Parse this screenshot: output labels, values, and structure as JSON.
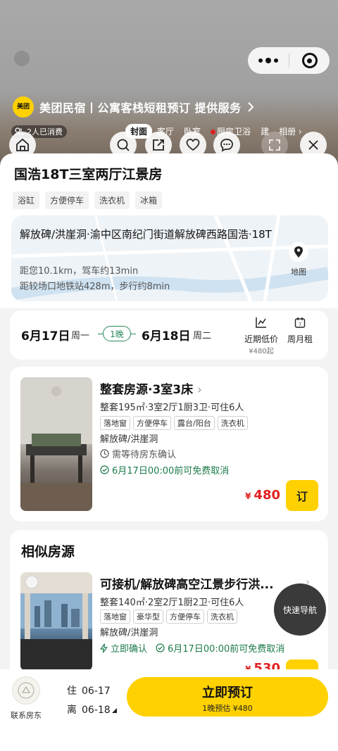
{
  "header": {
    "brand_logo_text": "美团",
    "brand_title": "美团民宿丨公寓客栈短租预订 提供服务",
    "consumed_badge": "2人已消费",
    "gallery_tabs": [
      "封面",
      "客厅",
      "卧室",
      "厨房卫浴",
      "建",
      "相册"
    ],
    "active_tab": "封面"
  },
  "listing": {
    "title": "国浩18T三室两厅江景房",
    "amenities": [
      "浴缸",
      "方便停车",
      "洗衣机",
      "冰箱"
    ]
  },
  "address": {
    "full": "解放碑/洪崖洞·渝中区南纪门街道解放碑西路国浩·18T",
    "distance_drive": "距您10.1km，驾车约13min",
    "distance_metro": "距较场口地铁站428m，步行约8min",
    "map_label": "地图"
  },
  "dates": {
    "checkin_date": "6月17日",
    "checkin_weekday": "周一",
    "nights": "1晚",
    "checkout_date": "6月18日",
    "checkout_weekday": "周二",
    "low_price_label": "近期低价",
    "low_price_value": "¥480起",
    "weekly_label": "周月租"
  },
  "room": {
    "title": "整套房源·3室3床",
    "spec": "整套195㎡·3室2厅1厨3卫·可住6人",
    "tags": [
      "落地窗",
      "方便停车",
      "露台/阳台",
      "洗衣机"
    ],
    "area": "解放碑/洪崖洞",
    "confirm": "需等待房东确认",
    "cancel": "6月17日00:00前可免费取消",
    "currency": "¥",
    "price": "480",
    "book_label": "订"
  },
  "similar": {
    "heading": "相似房源",
    "title": "可接机/解放碑高空江景步行洪...",
    "spec": "整套140㎡·2室2厅1厨2卫·可住6人",
    "tags": [
      "落地窗",
      "豪华型",
      "方便停车",
      "洗衣机"
    ],
    "area": "解放碑/洪崖洞",
    "instant": "立即确认",
    "cancel": "6月17日00:00前可免费取消",
    "currency": "¥",
    "price": "530"
  },
  "quick_nav": "快速导航",
  "bottom": {
    "contact_label": "联系房东",
    "checkin_prefix": "住",
    "checkin": "06-17",
    "checkout_prefix": "离",
    "checkout": "06-18",
    "book_main": "立即预订",
    "book_sub": "1晚预估 ¥480"
  },
  "colors": {
    "accent_yellow": "#ffd100",
    "price_red": "#e02020",
    "green": "#1c7a4a"
  }
}
